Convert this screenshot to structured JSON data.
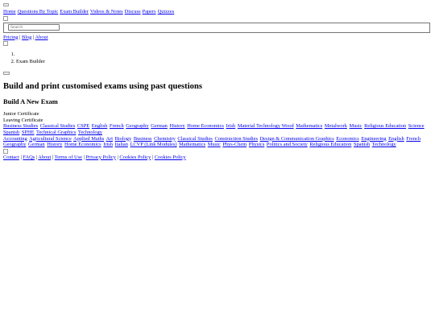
{
  "header": {
    "nav": [
      "Home",
      "Questions By Topic",
      "Exam Builder",
      "Videos & Notes",
      "Discuss",
      "Papers",
      "Quizzes"
    ],
    "search_placeholder": "Search",
    "secondary_links": [
      "Pricing",
      "Blog",
      "About"
    ]
  },
  "breadcrumb": {
    "items": [
      "",
      "Exam Builder"
    ]
  },
  "main": {
    "title": "Build and print customised exams using past questions",
    "subtitle": "Build A New Exam",
    "certificates": [
      "Junior Certificate",
      "Leaving Certificate"
    ],
    "junior_subjects": [
      "Business Studies",
      "Classical Studies",
      "CSPE",
      "English",
      "French",
      "Geography",
      "German",
      "History",
      "Home Economics",
      "Irish",
      "Material Technology Wood",
      "Mathematics",
      "Metalwork",
      "Music",
      "Religious Education",
      "Science",
      "Spanish",
      "SPHE",
      "Technical Graphics",
      "Technology"
    ],
    "leaving_subjects": [
      "Accounting",
      "Agricultural Science",
      "Applied Maths",
      "Art",
      "Biology",
      "Business",
      "Chemistry",
      "Classical Studies",
      "Construction Studies",
      "Design & Communication Graphics",
      "Economics",
      "Engineering",
      "English",
      "French",
      "Geography",
      "German",
      "History",
      "Home Economics",
      "Irish",
      "Italian",
      "LCVP (Link Modules)",
      "Mathematics",
      "Music",
      "Phys-Chem",
      "Physics",
      "Politics and Society",
      "Religious Education",
      "Spanish",
      "Technology"
    ]
  },
  "footer": {
    "links": [
      "Contact",
      "FAQs",
      "About",
      "Terms of Use",
      "Privacy Policy",
      "Cookies Policy",
      "Cookies Policy"
    ]
  }
}
